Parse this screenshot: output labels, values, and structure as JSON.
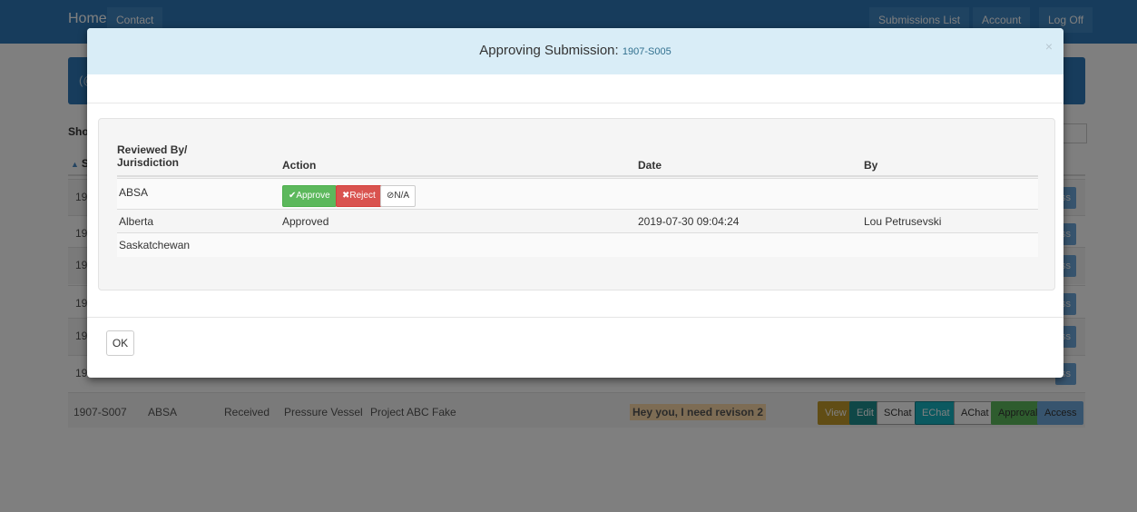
{
  "navbar": {
    "home": "Home",
    "contact": "Contact",
    "submissions_list": "Submissions List",
    "account": "Account",
    "log_off": "Log Off"
  },
  "background": {
    "banner_text": "(@",
    "show_label": "Show",
    "sort_header": "Su",
    "sort_icon": "sort-asc-icon",
    "rows": [
      {
        "id": "190",
        "access_label": "ss"
      },
      {
        "id": "190",
        "access_label": "ss"
      },
      {
        "id": "190",
        "access_label": "ss"
      },
      {
        "id": "190",
        "access_label": "ss"
      },
      {
        "id": "190",
        "access_label": "ss"
      },
      {
        "id": "190",
        "access_label": "ss"
      }
    ],
    "last_row": {
      "id": "1907-S007",
      "jurisdiction": "ABSA",
      "status": "Received",
      "type": "Pressure Vessel",
      "project": "Project ABC Fake",
      "message": "Hey you, I need revison 2",
      "buttons": {
        "view": "View",
        "edit": "Edit",
        "schat": "SChat",
        "echat": "EChat",
        "achat": "AChat",
        "approval": "Approval",
        "access": "Access"
      }
    }
  },
  "modal": {
    "title": "Approving Submission:",
    "submission_id": "1907-S005",
    "close": "×",
    "table": {
      "headers": {
        "reviewed_by_line1": "Reviewed By/",
        "reviewed_by_line2": "Jurisdiction",
        "action": "Action",
        "date": "Date",
        "by": "By"
      },
      "rows": [
        {
          "jurisdiction": "ABSA",
          "action": "",
          "date": "",
          "by": ""
        },
        {
          "jurisdiction": "Alberta",
          "action": "Approved",
          "date": "2019-07-30 09:04:24",
          "by": "Lou Petrusevski"
        },
        {
          "jurisdiction": "Saskatchewan",
          "action": "",
          "date": "",
          "by": ""
        }
      ],
      "action_buttons": {
        "approve": "✔Approve",
        "reject": "✖Reject",
        "na": "⊘N/A"
      }
    },
    "ok": "OK"
  },
  "colors": {
    "navbar": "#2f79b8",
    "modal_header": "#d9edf7",
    "approve": "#5cb85c",
    "reject": "#d9534f"
  }
}
